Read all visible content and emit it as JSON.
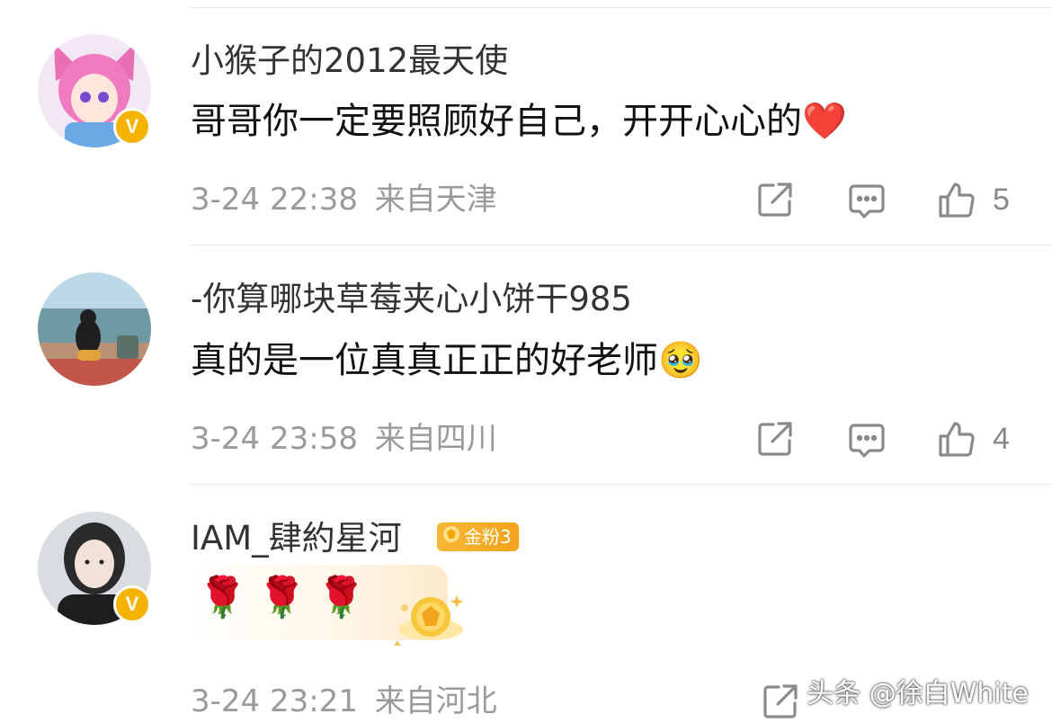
{
  "comments": [
    {
      "username": "小猴子的2012最天使",
      "text": "哥哥你一定要照顾好自己，开开心心的",
      "emoji": "❤️",
      "time": "3-24 22:38",
      "location": "来自天津",
      "likes": "5",
      "verified_badge": "V"
    },
    {
      "username": "-你算哪块草莓夹心小饼干985",
      "text": "真的是一位真真正正的好老师",
      "emoji": "🥹",
      "time": "3-24 23:58",
      "location": "来自四川",
      "likes": "4"
    },
    {
      "username": "IAM_肆約星河",
      "fan_badge": "金粉3",
      "roses": [
        "🌹",
        "🌹",
        "🌹"
      ],
      "time": "3-24 23:21",
      "location": "来自河北",
      "verified_badge": "V"
    }
  ],
  "watermark": "头条 @徐白White",
  "icons": {
    "share": "share-icon",
    "comment": "comment-icon",
    "like": "like-icon"
  },
  "colors": {
    "verified": "#f5b300",
    "meta_text": "#9a9a9a",
    "fan_badge": "#f4a21d"
  }
}
